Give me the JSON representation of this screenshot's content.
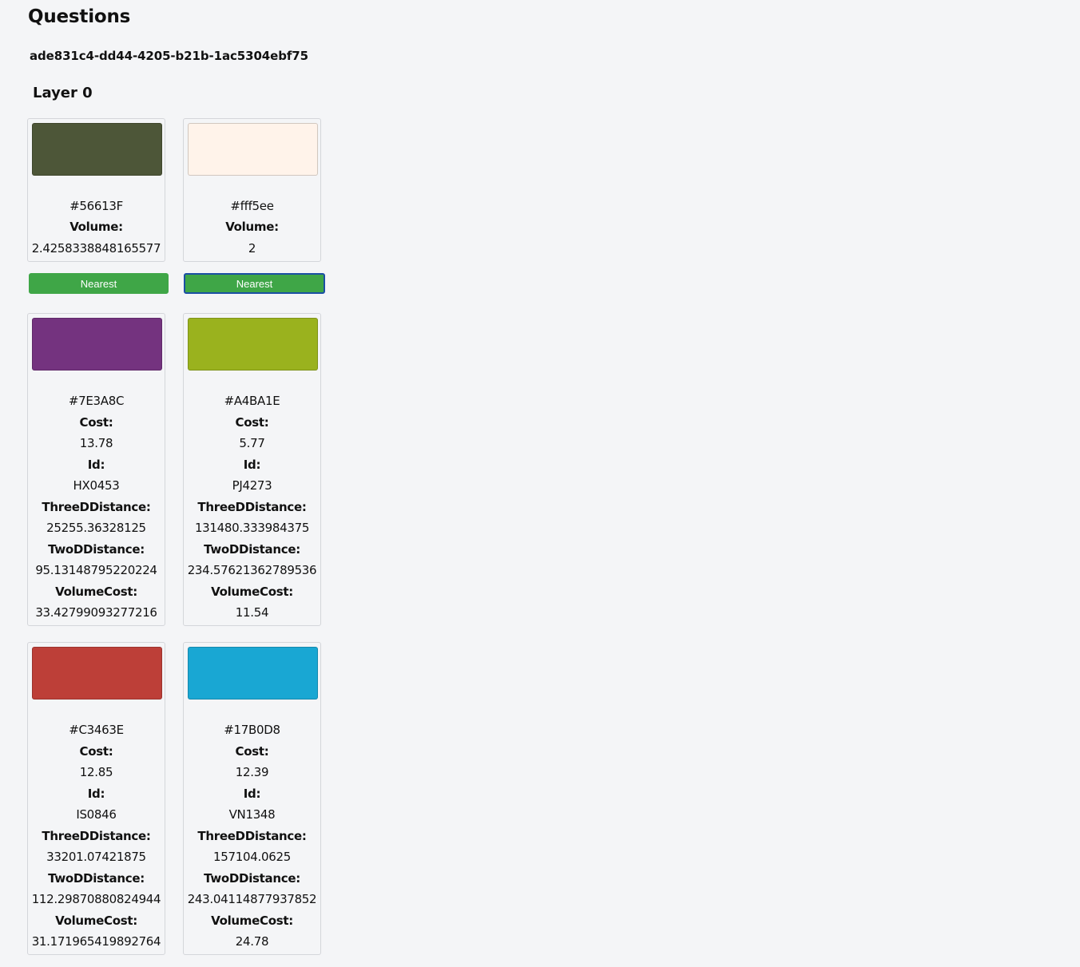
{
  "page": {
    "title": "Questions",
    "uuid": "ade831c4-dd44-4205-b21b-1ac5304ebf75",
    "layer_label": "Layer 0"
  },
  "buttons": {
    "nearest_label": "Nearest"
  },
  "targets": [
    {
      "hex": "#56613F",
      "swatch": "#4d5638",
      "volume_label": "Volume:",
      "volume": "2.4258338848165577"
    },
    {
      "hex": "#fff5ee",
      "swatch": "#fff3ea",
      "volume_label": "Volume:",
      "volume": "2"
    }
  ],
  "results": [
    {
      "hex": "#7E3A8C",
      "swatch": "#74337f",
      "cost_label": "Cost:",
      "cost": "13.78",
      "id_label": "Id:",
      "id": "HX0453",
      "three_label": "ThreeDDistance:",
      "three": "25255.36328125",
      "two_label": "TwoDDistance:",
      "two": "95.13148795220224",
      "vc_label": "VolumeCost:",
      "vc": "33.42799093277216"
    },
    {
      "hex": "#A4BA1E",
      "swatch": "#9ab21e",
      "cost_label": "Cost:",
      "cost": "5.77",
      "id_label": "Id:",
      "id": "PJ4273",
      "three_label": "ThreeDDistance:",
      "three": "131480.333984375",
      "two_label": "TwoDDistance:",
      "two": "234.57621362789536",
      "vc_label": "VolumeCost:",
      "vc": "11.54"
    },
    {
      "hex": "#C3463E",
      "swatch": "#bd3f38",
      "cost_label": "Cost:",
      "cost": "12.85",
      "id_label": "Id:",
      "id": "IS0846",
      "three_label": "ThreeDDistance:",
      "three": "33201.07421875",
      "two_label": "TwoDDistance:",
      "two": "112.29870880824944",
      "vc_label": "VolumeCost:",
      "vc": "31.171965419892764"
    },
    {
      "hex": "#17B0D8",
      "swatch": "#19a7d3",
      "cost_label": "Cost:",
      "cost": "12.39",
      "id_label": "Id:",
      "id": "VN1348",
      "three_label": "ThreeDDistance:",
      "three": "157104.0625",
      "two_label": "TwoDDistance:",
      "two": "243.04114877937852",
      "vc_label": "VolumeCost:",
      "vc": "24.78"
    }
  ]
}
